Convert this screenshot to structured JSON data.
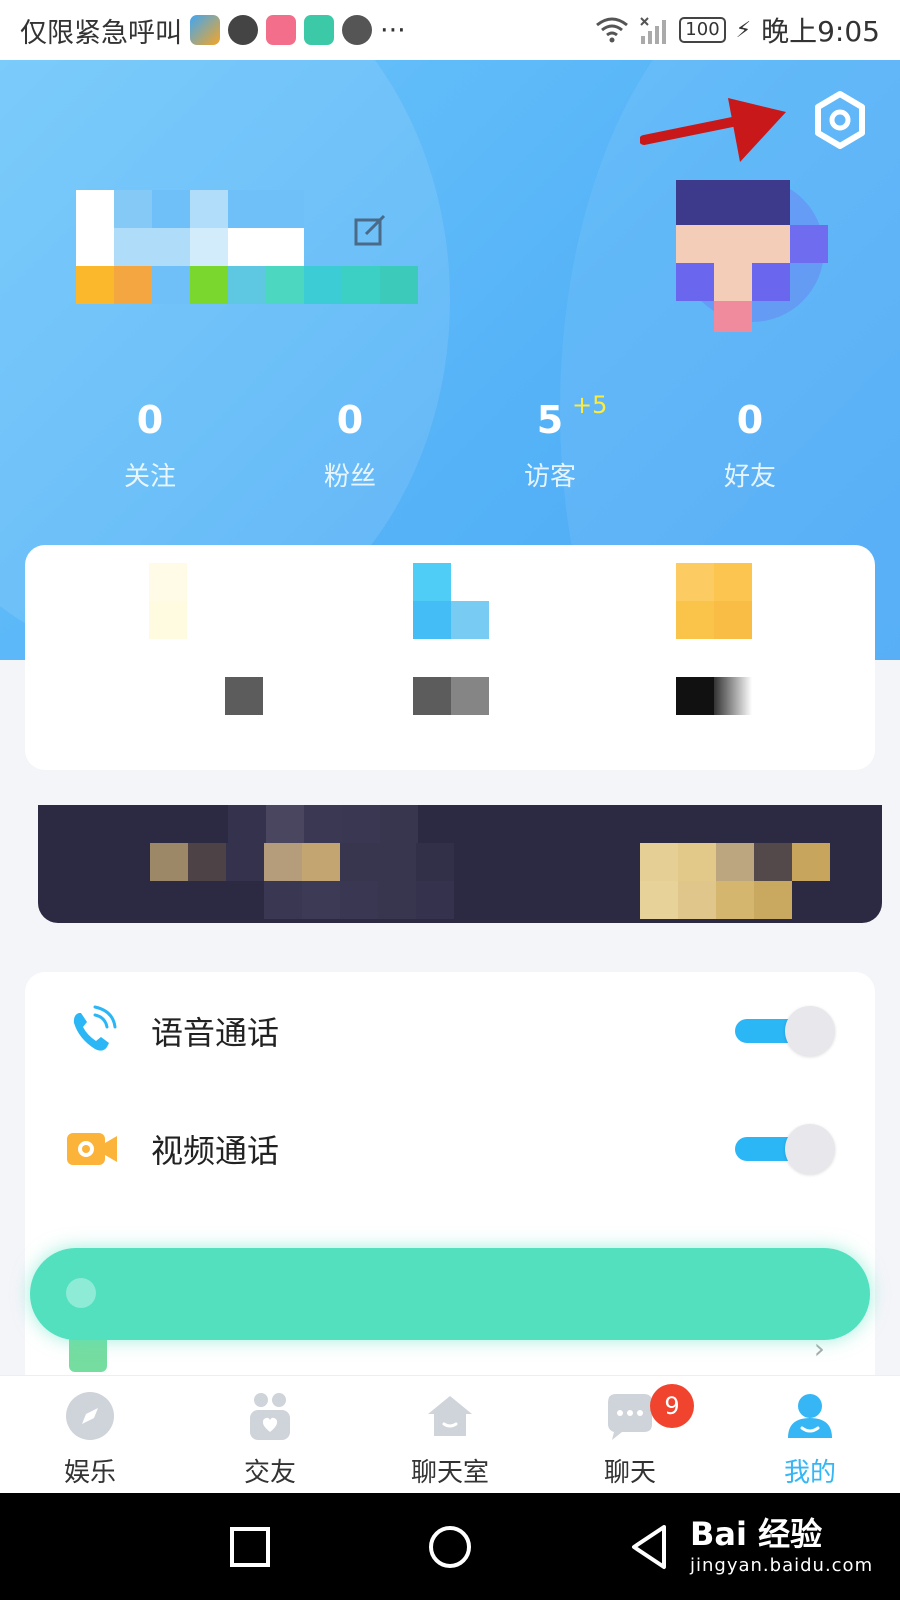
{
  "status_bar": {
    "left_text": "仅限紧急呼叫",
    "more": "···",
    "battery": "100",
    "time": "晚上9:05"
  },
  "profile": {
    "stats": [
      {
        "num": "0",
        "label": "关注"
      },
      {
        "num": "0",
        "label": "粉丝"
      },
      {
        "num": "5",
        "label": "访客",
        "plus": "+5"
      },
      {
        "num": "0",
        "label": "好友"
      }
    ]
  },
  "settings": {
    "voice_call": "语音通话",
    "video_call": "视频通话",
    "voice_call_enabled": true,
    "video_call_enabled": true
  },
  "tabs": [
    {
      "label": "娱乐"
    },
    {
      "label": "交友"
    },
    {
      "label": "聊天室"
    },
    {
      "label": "聊天",
      "badge": "9"
    },
    {
      "label": "我的"
    }
  ],
  "watermark": {
    "main": "Bai 经验",
    "sub": "jingyan.baidu.com"
  },
  "colors": {
    "accent": "#36b6f5",
    "header": "#56b3f7",
    "badge": "#f0442e",
    "float_bar": "#52e0bf",
    "toggle_on": "#2bb6f6"
  }
}
